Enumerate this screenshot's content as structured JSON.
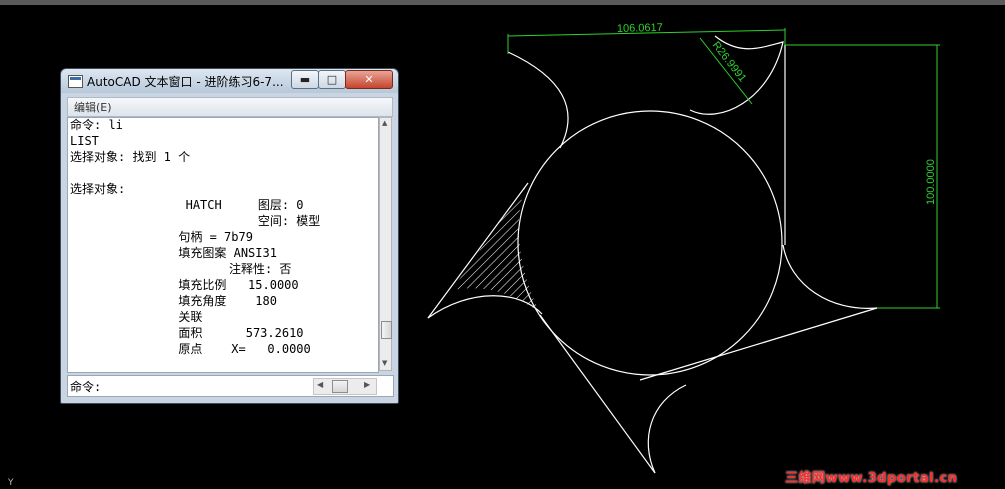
{
  "window": {
    "title": "AutoCAD 文本窗口 - 进阶练习6-7...",
    "menu_edit": "编辑(E)",
    "min_label": "▬",
    "max_label": "□",
    "close_label": "✕",
    "lines": [
      "命令: li",
      "LIST",
      "选择对象: 找到 1 个",
      "",
      "选择对象:",
      "                HATCH     图层: 0",
      "                          空间: 模型",
      "               句柄 = 7b79",
      "               填充图案 ANSI31",
      "                      注释性: 否",
      "               填充比例   15.0000",
      "               填充角度    180",
      "               关联",
      "               面积      573.2610",
      "               原点    X=   0.0000"
    ],
    "command_prompt": "命令:"
  },
  "dimensions": {
    "top_length": "106.0617",
    "radius": "R26.9991",
    "right_length": "100.0000"
  },
  "ucs_label": "Y",
  "watermark": "三维网www.3dportal.cn",
  "colors": {
    "background": "#000000",
    "geometry": "#ffffff",
    "dimension": "#2fd12f",
    "watermark": "#ff2a2a"
  },
  "icons": [
    "app-icon",
    "minimize-icon",
    "maximize-icon",
    "close-icon",
    "scroll-up-icon",
    "scroll-down-icon",
    "scroll-left-icon",
    "scroll-right-icon"
  ]
}
